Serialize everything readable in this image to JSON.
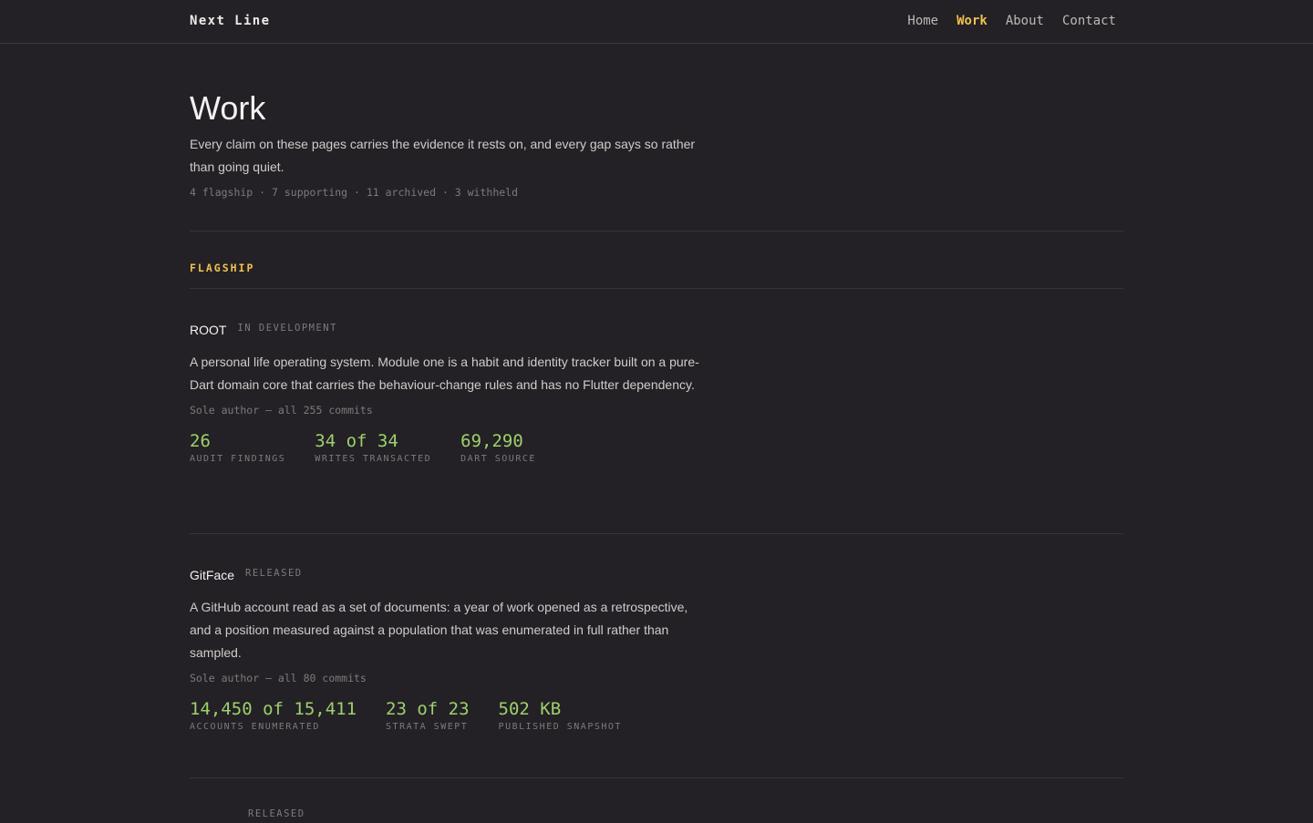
{
  "header": {
    "brand": "Next Line",
    "nav": [
      {
        "label": "Home",
        "active": false
      },
      {
        "label": "Work",
        "active": true
      },
      {
        "label": "About",
        "active": false
      },
      {
        "label": "Contact",
        "active": false
      }
    ]
  },
  "page": {
    "title": "Work",
    "lede": "Every claim on these pages carries the evidence it rests on, and every gap says so rather than going quiet.",
    "counts": "4 flagship · 7 supporting · 11 archived · 3 withheld"
  },
  "section": {
    "label": "FLAGSHIP"
  },
  "colors": {
    "accent": "#f2c14e",
    "metric": "#9ed06c",
    "background": "#232125"
  },
  "projects": [
    {
      "title": "ROOT",
      "status": "IN DEVELOPMENT",
      "description": "A personal life operating system. Module one is a habit and identity tracker built on a pure-Dart domain core that carries the behaviour-change rules and has no Flutter dependency.",
      "author": "Sole author — all 255 commits",
      "metrics": [
        {
          "value": "26",
          "label": "AUDIT FINDINGS"
        },
        {
          "value": "34 of 34",
          "label": "WRITES TRANSACTED"
        },
        {
          "value": "69,290",
          "label": "DART SOURCE"
        }
      ]
    },
    {
      "title": "GitFace",
      "status": "RELEASED",
      "description": "A GitHub account read as a set of documents: a year of work opened as a retrospective, and a position measured against a population that was enumerated in full rather than sampled.",
      "author": "Sole author — all 80 commits",
      "metrics": [
        {
          "value": "14,450 of 15,411",
          "label": "ACCOUNTS ENUMERATED"
        },
        {
          "value": "23 of 23",
          "label": "STRATA SWEPT"
        },
        {
          "value": "502 KB",
          "label": "PUBLISHED SNAPSHOT"
        }
      ]
    },
    {
      "title": "",
      "status": "RELEASED"
    }
  ]
}
